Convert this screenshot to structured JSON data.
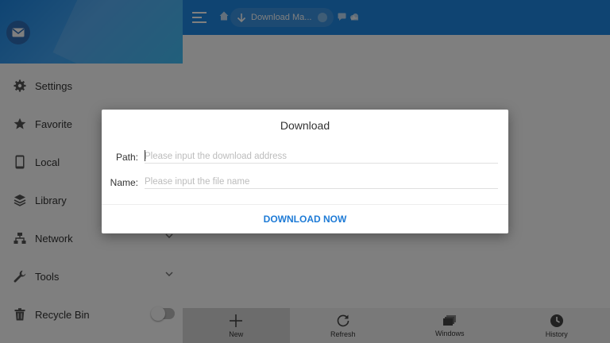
{
  "sidebar": {
    "items": [
      {
        "label": "Settings",
        "icon": "gear-icon"
      },
      {
        "label": "Favorite",
        "icon": "star-icon"
      },
      {
        "label": "Local",
        "icon": "phone-icon"
      },
      {
        "label": "Library",
        "icon": "layers-icon"
      },
      {
        "label": "Network",
        "icon": "network-icon"
      },
      {
        "label": "Tools",
        "icon": "wrench-icon"
      },
      {
        "label": "Recycle Bin",
        "icon": "trash-icon"
      }
    ]
  },
  "topbar": {
    "tab_title": "Download Ma..."
  },
  "bottombar": {
    "items": [
      {
        "label": "New",
        "icon": "plus-icon"
      },
      {
        "label": "Refresh",
        "icon": "refresh-icon"
      },
      {
        "label": "Windows",
        "icon": "windows-icon"
      },
      {
        "label": "History",
        "icon": "history-icon"
      }
    ]
  },
  "dialog": {
    "title": "Download",
    "path_label": "Path:",
    "path_placeholder": "Please input the download address",
    "path_value": "",
    "name_label": "Name:",
    "name_placeholder": "Please input the file name",
    "name_value": "",
    "button_label": "DOWNLOAD NOW"
  },
  "colors": {
    "accent": "#1e88e5",
    "button_text": "#1e7bd6"
  }
}
